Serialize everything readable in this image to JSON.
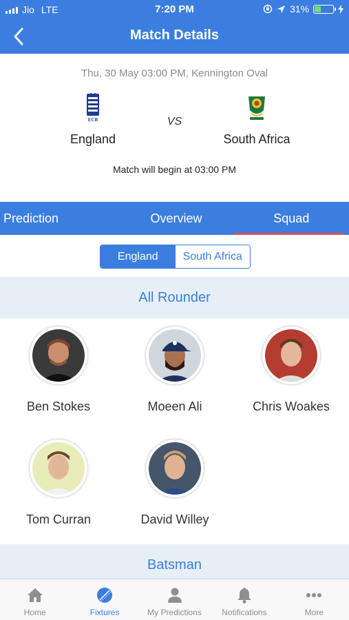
{
  "status_bar": {
    "carrier": "Jio",
    "network": "LTE",
    "time": "7:20 PM",
    "battery_percent": "31%",
    "battery_level": 0.31
  },
  "header": {
    "title": "Match Details",
    "back_icon": "chevron-left-icon"
  },
  "match": {
    "datetime": "Thu, 30 May 03:00 PM, Kennington Oval",
    "vs": "VS",
    "status": "Match will begin at 03:00 PM",
    "team1": {
      "name": "England",
      "logo_icon": "ecb-crest-icon"
    },
    "team2": {
      "name": "South Africa",
      "logo_icon": "protea-crest-icon"
    }
  },
  "tabs": [
    {
      "label": "Prediction",
      "active": false
    },
    {
      "label": "Overview",
      "active": false
    },
    {
      "label": "Squad",
      "active": true
    }
  ],
  "segment": {
    "options": [
      "England",
      "South Africa"
    ],
    "selected": "England"
  },
  "sections": [
    {
      "title": "All Rounder",
      "players": [
        "Ben Stokes",
        "Moeen Ali",
        "Chris Woakes",
        "Tom Curran",
        "David Willey"
      ]
    },
    {
      "title": "Batsman"
    }
  ],
  "bottom_nav": [
    {
      "label": "Home",
      "icon": "home-icon",
      "active": false
    },
    {
      "label": "Fixtures",
      "icon": "cricket-ball-icon",
      "active": true
    },
    {
      "label": "My Predictions",
      "icon": "user-icon",
      "active": false
    },
    {
      "label": "Notifications",
      "icon": "bell-icon",
      "active": false
    },
    {
      "label": "More",
      "icon": "more-dots-icon",
      "active": false
    }
  ],
  "colors": {
    "primary": "#3b7ee0",
    "tab_indicator": "#e2505a",
    "section_bg": "#e6eff7",
    "battery_fill": "#6ee06b"
  }
}
